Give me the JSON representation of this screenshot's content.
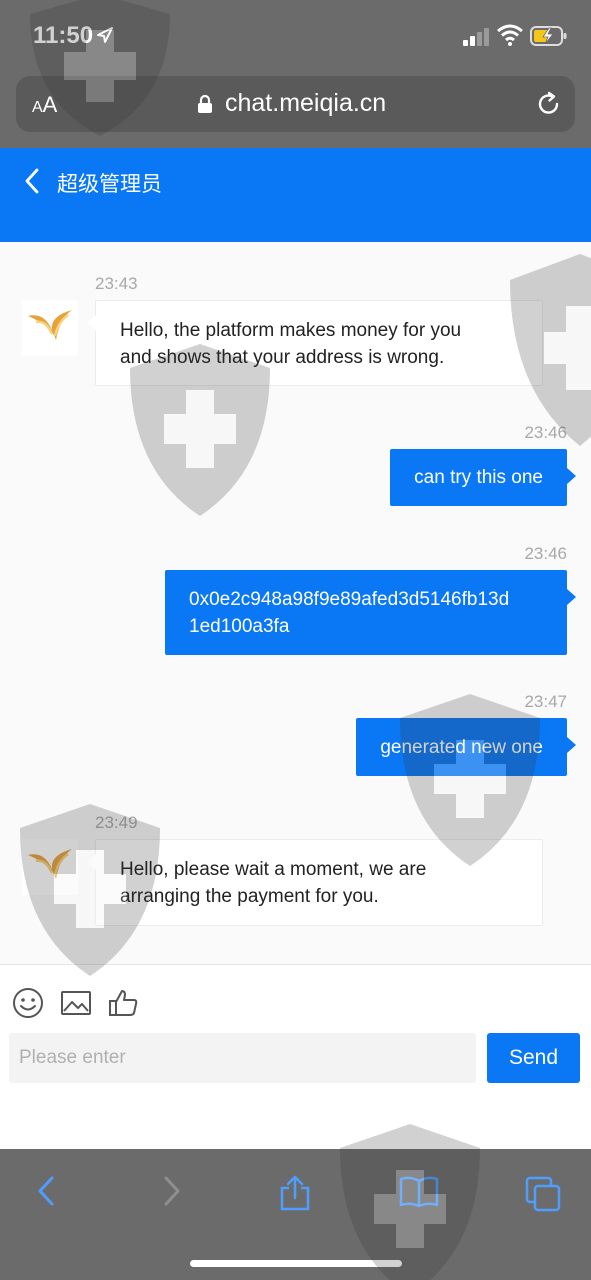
{
  "status": {
    "time": "11:50"
  },
  "browser": {
    "text_size_label_small": "A",
    "text_size_label_large": "A",
    "url": "chat.meiqia.cn"
  },
  "header": {
    "title": "超级管理员"
  },
  "messages": [
    {
      "direction": "in",
      "time": "23:43",
      "lines": [
        "Hello, the platform makes money for you",
        "and shows that your address is wrong."
      ]
    },
    {
      "direction": "out",
      "time": "23:46",
      "lines": [
        "can try this one"
      ]
    },
    {
      "direction": "out",
      "time": "23:46",
      "lines": [
        "0x0e2c948a98f9e89afed3d5146fb13d",
        "1ed100a3fa"
      ]
    },
    {
      "direction": "out",
      "time": "23:47",
      "lines": [
        "generated new one"
      ]
    },
    {
      "direction": "in",
      "time": "23:49",
      "lines": [
        "Hello, please wait a moment, we are",
        "arranging the payment for you."
      ]
    }
  ],
  "composer": {
    "placeholder": "Please enter",
    "value": "",
    "send_label": "Send",
    "tools": [
      "emoji-icon",
      "image-icon",
      "thumbs-up-icon"
    ]
  },
  "toolbar": {
    "icons": [
      "back-icon",
      "forward-icon",
      "share-icon",
      "bookmarks-icon",
      "tabs-icon"
    ]
  },
  "colors": {
    "accent": "#0a78f5",
    "chrome": "#6b6b6b",
    "battery": "#f5c518"
  }
}
